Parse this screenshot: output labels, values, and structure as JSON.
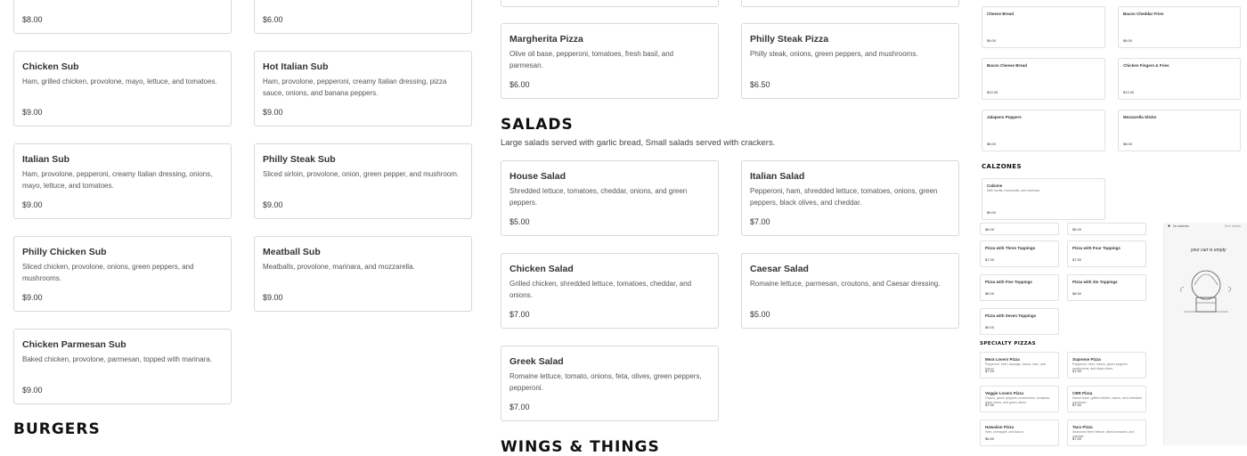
{
  "subs": {
    "top_left_price": "$8.00",
    "top_mid_price": "$6.00",
    "items": [
      {
        "name": "Chicken Sub",
        "desc": "Ham, grilled chicken, provolone, mayo, lettuce, and tomatoes.",
        "price": "$9.00"
      },
      {
        "name": "Hot Italian Sub",
        "desc": "Ham, provolone, pepperoni, creamy Italian dressing, pizza sauce, onions, and banana peppers.",
        "price": "$9.00"
      },
      {
        "name": "Italian Sub",
        "desc": "Ham, provolone, pepperoni, creamy Italian dressing, onions, mayo, lettuce, and tomatoes.",
        "price": "$9.00"
      },
      {
        "name": "Philly Steak Sub",
        "desc": "Sliced sirloin, provolone, onion, green pepper, and mushroom.",
        "price": "$9.00"
      },
      {
        "name": "Philly Chicken Sub",
        "desc": "Sliced chicken, provolone, onions, green peppers, and mushrooms.",
        "price": "$9.00"
      },
      {
        "name": "Meatball Sub",
        "desc": "Meatballs, provolone, marinara, and mozzarella.",
        "price": "$9.00"
      },
      {
        "name": "Chicken Parmesan Sub",
        "desc": "Baked chicken, provolone, parmesan, topped with marinara.",
        "price": "$9.00"
      }
    ]
  },
  "burgers": {
    "title": "BURGERS"
  },
  "pizzas": [
    {
      "name": "Margherita Pizza",
      "desc": "Olive oil base, pepperoni, tomatoes, fresh basil, and parmesan.",
      "price": "$6.00"
    },
    {
      "name": "Philly Steak Pizza",
      "desc": "Philly steak, onions, green peppers, and mushrooms.",
      "price": "$6.50"
    }
  ],
  "salads": {
    "title": "SALADS",
    "subtitle": "Large salads served with garlic bread, Small salads served with crackers.",
    "items": [
      {
        "name": "House Salad",
        "desc": "Shredded lettuce, tomatoes, cheddar, onions, and green peppers.",
        "price": "$5.00"
      },
      {
        "name": "Italian Salad",
        "desc": "Pepperoni, ham, shredded lettuce, tomatoes, onions, green peppers, black olives, and cheddar.",
        "price": "$7.00"
      },
      {
        "name": "Chicken Salad",
        "desc": "Grilled chicken, shredded lettuce, tomatoes, cheddar, and onions.",
        "price": "$7.00"
      },
      {
        "name": "Caesar Salad",
        "desc": "Romaine lettuce, parmesan, croutons, and Caesar dressing.",
        "price": "$5.00"
      },
      {
        "name": "Greek Salad",
        "desc": "Romaine lettuce, tomato, onions, feta, olives, green peppers, pepperoni.",
        "price": "$7.00"
      }
    ]
  },
  "wings": {
    "title": "WINGS & THINGS"
  },
  "thumb": {
    "sides": [
      {
        "name": "Cheese Bread",
        "price": "$8.00"
      },
      {
        "name": "Bacon Cheddar Fries",
        "price": "$8.00"
      },
      {
        "name": "Bacon Cheese Bread",
        "price": "$10.00"
      },
      {
        "name": "Chicken Fingers & Fries",
        "price": "$12.00"
      },
      {
        "name": "Jalapeno Poppers",
        "price": "$8.00"
      },
      {
        "name": "Mozzarella Sticks",
        "price": "$8.00"
      }
    ],
    "calzones_title": "CALZONES",
    "calzone": {
      "name": "Calzone",
      "desc": "With ricotta, mozzarella, and marinara.",
      "price": "$9.00"
    },
    "toppings_prices": [
      "$6.00",
      "$6.00"
    ],
    "toppings": [
      {
        "name": "Pizza with Three Toppings",
        "price": "$7.00"
      },
      {
        "name": "Pizza with Four Toppings",
        "price": "$7.50"
      },
      {
        "name": "Pizza with Five Toppings",
        "price": "$8.00"
      },
      {
        "name": "Pizza with Six Toppings",
        "price": "$8.50"
      },
      {
        "name": "Pizza with Seven Toppings",
        "price": "$9.00"
      }
    ],
    "specialty_title": "SPECIALTY PIZZAS",
    "specialty": [
      {
        "name": "Meat Lovers Pizza",
        "desc": "Pepperoni, beef, sausage, bacon, ham, and bacon.",
        "price": "$7.00"
      },
      {
        "name": "Supreme Pizza",
        "desc": "Pepperoni, beef, onions, green peppers, mushrooms, and black olives.",
        "price": "$7.50"
      },
      {
        "name": "Veggie Lovers Pizza",
        "desc": "Onions, green peppers, mushrooms, tomatoes, black olives, and green olives.",
        "price": "$7.00"
      },
      {
        "name": "CBR Pizza",
        "desc": "Ranch base, grilled chicken, bacon, and shredded parmesan.",
        "price": "$7.50"
      },
      {
        "name": "Hawaiian Pizza",
        "desc": "Ham, pineapple, and bacon.",
        "price": "$6.50"
      },
      {
        "name": "Taco Pizza",
        "desc": "Seasoned beef, lettuce, diced tomatoes, and cheddar.",
        "price": "$7.00"
      }
    ],
    "preview_address": "No address",
    "preview_right": "Item details",
    "preview_note": "your cart is empty"
  }
}
